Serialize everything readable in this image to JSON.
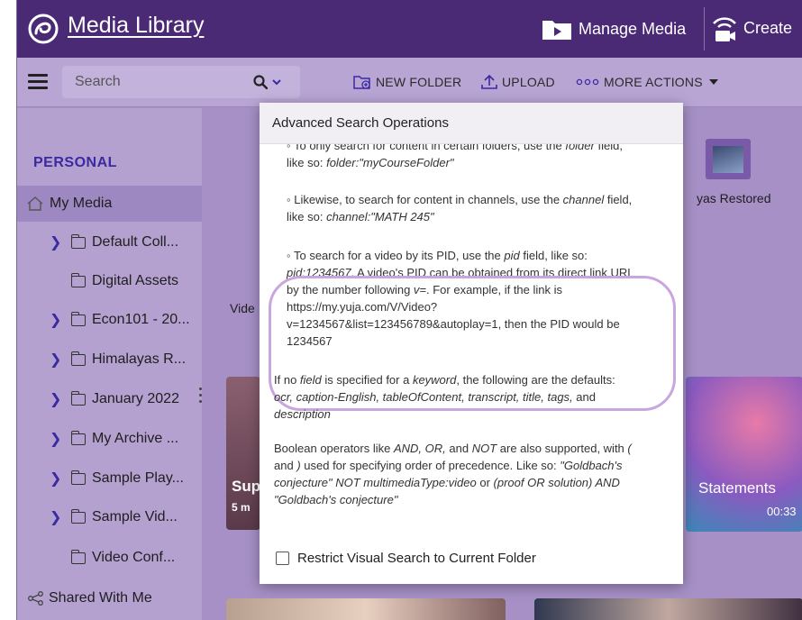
{
  "app": {
    "title": "Media Library",
    "manage_media_label": "Manage Media",
    "create_label": "Create"
  },
  "toolbar": {
    "search_placeholder": "Search",
    "new_folder_label": "NEW FOLDER",
    "upload_label": "UPLOAD",
    "more_actions_label": "MORE ACTIONS"
  },
  "sidebar": {
    "section_label": "PERSONAL",
    "my_media_label": "My Media",
    "items": [
      {
        "label": "Default Coll...",
        "has_children": true
      },
      {
        "label": "Digital Assets",
        "has_children": false
      },
      {
        "label": "Econ101 - 20...",
        "has_children": true
      },
      {
        "label": "Himalayas R...",
        "has_children": true
      },
      {
        "label": "January 2022",
        "has_children": true
      },
      {
        "label": "My Archive ...",
        "has_children": true
      },
      {
        "label": "Sample Play...",
        "has_children": true
      },
      {
        "label": "Sample Vid...",
        "has_children": true
      },
      {
        "label": "Video Conf...",
        "has_children": false
      }
    ],
    "shared_label": "Shared With Me"
  },
  "background": {
    "folder_label": "yas Restored",
    "partial_label": "Vide",
    "card_left_title": "Sup",
    "card_left_meta": "5 m",
    "card_right_title": "Statements",
    "card_right_duration": "00:33"
  },
  "popup": {
    "title": "Advanced Search Operations",
    "item1_line1": "◦ To only search for content in certain folders, use the ",
    "item1_em": "folder",
    "item1_line1_end": " field,",
    "item1_line2": "like so: ",
    "item1_example": "folder:\"myCourseFolder\"",
    "item2_line1": "◦ Likewise, to search for content in channels, use the ",
    "item2_em": "channel",
    "item2_line1_end": " field,",
    "item2_line2": "like so: ",
    "item2_example": "channel:\"MATH 245\"",
    "item3_a": "◦ To search for a video by its PID, use the ",
    "item3_em1": "pid",
    "item3_b": " field, like so:",
    "item3_example": "pid:1234567.",
    "item3_c": " A video's PID can be obtained from its direct link URL",
    "item3_d": "by the number following ",
    "item3_em2": "v=",
    "item3_e": ". For example, if the link is",
    "item3_f": "https://my.yuja.com/V/Video?",
    "item3_g": "v=1234567&list=123456789&autoplay=1, then the PID would be",
    "item3_h": "1234567",
    "default_a": "If no ",
    "default_em1": "field",
    "default_b": " is specified for a ",
    "default_em2": "keyword",
    "default_c": ", the following are the defaults:",
    "default_list": "ocr, caption-English, tableOfContent, transcript, title, tags,",
    "default_and": " and",
    "default_last": "description",
    "bool_a": "Boolean operators like ",
    "bool_and": "AND, OR,",
    "bool_b": " and ",
    "bool_not": "NOT",
    "bool_c": " are also supported, with ",
    "bool_paren_open": "(",
    "bool_d": "and ",
    "bool_paren_close": ")",
    "bool_e": " used for specifying order of precedence. Like so: ",
    "bool_ex1": "\"Goldbach's",
    "bool_ex2": "conjecture\" NOT multimediaType:video",
    "bool_or": " or ",
    "bool_ex3": "(proof OR solution) AND",
    "bool_ex4": "\"Goldbach's conjecture\"",
    "checkbox_label": "Restrict Visual Search to Current Folder"
  },
  "colors": {
    "appbar": "#4a2a75",
    "accent": "#3a2aa0",
    "highlight_ring": "#c9a6de"
  }
}
